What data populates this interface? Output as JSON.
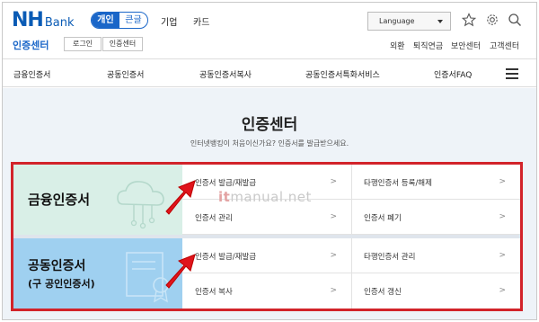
{
  "brand": {
    "nh": "NH",
    "bank": "Bank"
  },
  "segment": {
    "personal": "개인",
    "large_text": "큰글"
  },
  "topnav": {
    "corporate": "기업",
    "card": "카드"
  },
  "language": {
    "label": "Language"
  },
  "sub_header": {
    "title": "인증센터",
    "login": "로그인",
    "cert_center": "인증센터",
    "links": [
      "외환",
      "퇴직연금",
      "보안센터",
      "고객센터"
    ]
  },
  "mainnav": {
    "items": [
      "금융인증서",
      "공동인증서",
      "공동인증서복사",
      "공동인증서특화서비스",
      "인증서FAQ"
    ]
  },
  "page": {
    "title": "인증센터",
    "subtitle": "인터넷뱅킹이 처음이신가요? 인증서를 발급받으세요."
  },
  "panel": {
    "financial": {
      "label": "금융인증서",
      "items": [
        "인증서 발급/재발급",
        "타행인증서 등록/해제",
        "인증서 관리",
        "인증서 폐기"
      ]
    },
    "joint": {
      "label_line1": "공동인증서",
      "label_line2": "(구 공인인증서)",
      "items": [
        "인증서 발급/재발급",
        "타행인증서 관리",
        "인증서 복사",
        "인증서 갱신"
      ]
    },
    "chevron": ">"
  },
  "watermark": {
    "it": "it",
    "rest": "manual.net"
  },
  "colors": {
    "brand": "#0a5bb5",
    "accent": "#1a66c8",
    "highlight": "#d2232a"
  }
}
